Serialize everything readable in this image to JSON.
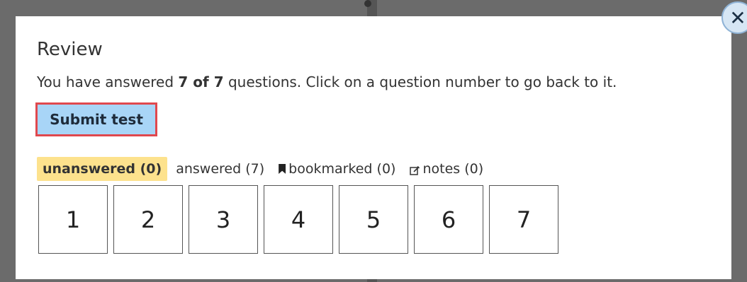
{
  "modal": {
    "title": "Review",
    "desc_prefix": "You have answered ",
    "desc_count": "7 of 7",
    "desc_suffix": " questions. Click on a question number to go back to it.",
    "submit_label": "Submit test",
    "close_icon": "close-icon"
  },
  "filters": [
    {
      "label": "unanswered (0)",
      "active": true
    },
    {
      "label": "answered (7)",
      "active": false
    },
    {
      "label": "bookmarked (0)",
      "active": false,
      "icon": "bookmark-icon"
    },
    {
      "label": "notes (0)",
      "active": false,
      "icon": "note-icon"
    }
  ],
  "questions": [
    "1",
    "2",
    "3",
    "4",
    "5",
    "6",
    "7"
  ],
  "colors": {
    "submit_bg": "#a8d5f7",
    "submit_border": "#e0484e",
    "filter_active_bg": "#fde28d",
    "overlay": "#6b6b6b"
  }
}
